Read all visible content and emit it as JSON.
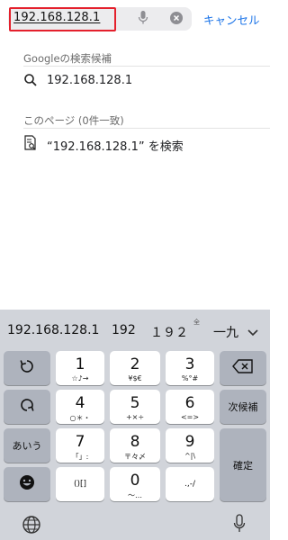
{
  "search": {
    "value": "192.168.128.1",
    "cancel_label": "キャンセル"
  },
  "suggestions": {
    "google_header": "Googleの検索候補",
    "google_items": [
      {
        "text": "192.168.128.1",
        "icon": "search-icon"
      }
    ],
    "page_header": "このページ (0件一致)",
    "page_items": [
      {
        "text": "“192.168.128.1” を検索",
        "icon": "find-in-page-icon"
      }
    ]
  },
  "keyboard": {
    "candidates": [
      "192.168.128.1",
      "192",
      "１９２",
      "一九"
    ],
    "candidate_superscript": "全",
    "keys": {
      "undo": {
        "icon": "undo-icon"
      },
      "k1": {
        "main": "1",
        "sub": "☆♪→"
      },
      "k2": {
        "main": "2",
        "sub": "¥$€"
      },
      "k3": {
        "main": "3",
        "sub": "%°#"
      },
      "backspace": {
        "icon": "backspace-icon"
      },
      "redo": {
        "icon": "redo-icon"
      },
      "k4": {
        "main": "4",
        "sub": "○＊・"
      },
      "k5": {
        "main": "5",
        "sub": "+×÷"
      },
      "k6": {
        "main": "6",
        "sub": "<=>"
      },
      "next_candidate": {
        "label": "次候補"
      },
      "mode": {
        "label": "あいう"
      },
      "k7": {
        "main": "7",
        "sub": "「」:"
      },
      "k8": {
        "main": "8",
        "sub": "〒々〆"
      },
      "k9": {
        "main": "9",
        "sub": "^|\\"
      },
      "enter": {
        "label": "確定"
      },
      "emoji": {
        "icon": "emoji-icon"
      },
      "brackets": {
        "label": "()[]"
      },
      "k0": {
        "main": "0",
        "sub": "〜…"
      },
      "punct": {
        "label": ".,-/"
      }
    },
    "bottom": {
      "globe_icon": "globe-icon",
      "mic_icon": "mic-icon"
    }
  },
  "colors": {
    "accent": "#1a73e8",
    "highlight": "#e4202c",
    "keyboard_bg": "#d1d4da",
    "dark_key": "#aeb3bd"
  }
}
